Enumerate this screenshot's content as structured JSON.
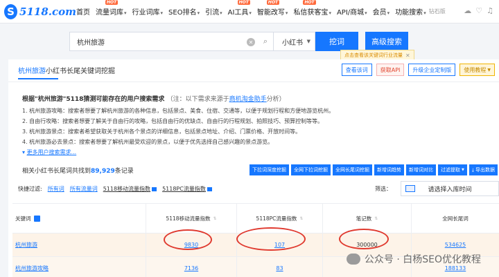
{
  "logo": {
    "mark": "S",
    "text": "5118.com"
  },
  "nav": {
    "items": [
      {
        "label": "首页",
        "chev": false,
        "hot": false
      },
      {
        "label": "流量词库",
        "chev": true,
        "hot": true
      },
      {
        "label": "行业词库",
        "chev": true,
        "hot": false
      },
      {
        "label": "SEO排名",
        "chev": true,
        "hot": false
      },
      {
        "label": "引流",
        "chev": true,
        "hot": false
      },
      {
        "label": "AI工具",
        "chev": true,
        "hot": true
      },
      {
        "label": "智能改写",
        "chev": true,
        "hot": true
      },
      {
        "label": "私信获客宝",
        "chev": true,
        "hot": true
      },
      {
        "label": "API/商城",
        "chev": true,
        "hot": false
      },
      {
        "label": "会员",
        "chev": true,
        "hot": false
      },
      {
        "label": "功能搜索",
        "chev": true,
        "hot": false
      }
    ],
    "hot_label": "HOT",
    "vip_text": "钻石版"
  },
  "search": {
    "value": "杭州旅游",
    "platform": "小红书",
    "dig_label": "挖词",
    "advanced_label": "高级搜索",
    "tip": "点击查看该关键词行业流量"
  },
  "panel": {
    "title_keyword": "杭州旅游",
    "title_rest": "小红书长尾关键词挖掘",
    "buttons": {
      "view": "查看该词",
      "api": "获取API",
      "enterprise": "升级企业定制版",
      "tutorial": "使用教程"
    }
  },
  "intro": {
    "head": "根据\"杭州旅游\"5118猜测可能存在的用户搜索需求",
    "note_prefix": "（注：以下需求来源于",
    "note_link": "商机淘金助手",
    "note_suffix": "分析）",
    "lines": [
      "1. 杭州旅游攻略：搜索者想要了解杭州旅游的各种信息，包括景点、美食、住宿、交通等，以便于规划行程和方便地游览杭州。",
      "2. 自由行攻略：搜索者想要了解关于自由行的攻略，包括自由行的优缺点、自由行的行程规划、拍照技巧、预算控制等等。",
      "3. 杭州旅游景点：搜索者希望获取关于杭州各个景点的详细信息，包括景点地址、介绍、门票价格、开放时间等。",
      "4. 杭州旅游必去景点：搜索者想要了解杭州最受欢迎的景点，以便于优先选择自己感兴趣的景点游览。"
    ],
    "more": "更多用户搜索需求..."
  },
  "results": {
    "prefix": "相关小红书长尾词共找到",
    "count": "89,929",
    "suffix": "条记录",
    "actions": [
      "下拉词深度挖掘",
      "全网下拉词挖掘",
      "全网长尾词挖掘",
      "新增词趋势",
      "新增词对比",
      "过滤提取",
      "导出数据"
    ]
  },
  "filters": {
    "label": "快捷过滤:",
    "items": [
      "所有词",
      "所有流量词",
      "5118移动流量指数",
      "5118PC流量指数"
    ],
    "screen_label": "筛选：",
    "date_placeholder": "请选择入库时间"
  },
  "table": {
    "headers": [
      "关键词",
      "5118移动流量指数",
      "5118PC流量指数",
      "笔记数",
      "全网长尾词"
    ],
    "rows": [
      {
        "keyword": "杭州旅游",
        "mobile": "9830",
        "pc": "107",
        "notes": "300000",
        "longtail": "534625"
      },
      {
        "keyword": "杭州旅游攻略",
        "mobile": "7136",
        "pc": "83",
        "notes": "",
        "longtail": "188133"
      }
    ]
  },
  "watermark": "公众号 · 白杨SEO优化教程",
  "colors": {
    "accent": "#1677ff",
    "highlight_circle": "#e03a2f",
    "hot": "#ff6b3d"
  }
}
